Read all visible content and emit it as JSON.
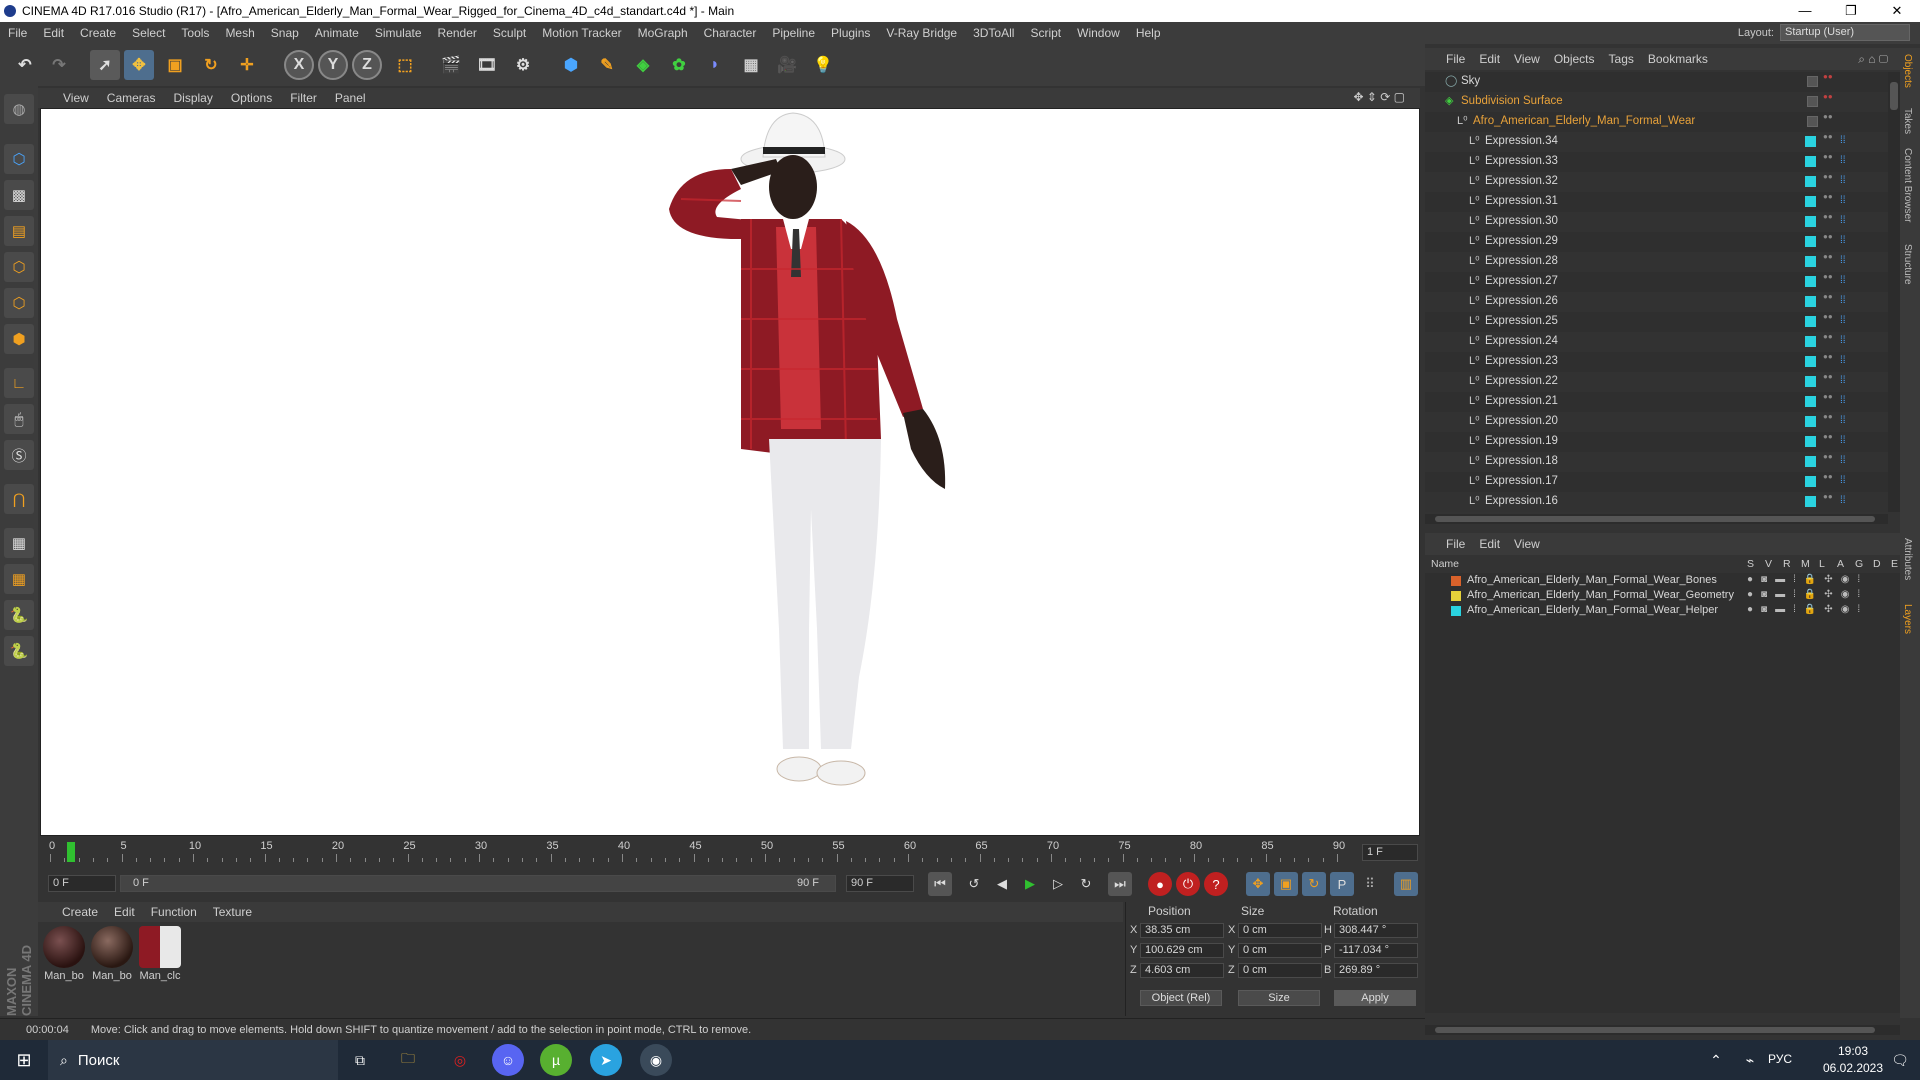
{
  "window": {
    "title": "CINEMA 4D R17.016 Studio (R17) - [Afro_American_Elderly_Man_Formal_Wear_Rigged_for_Cinema_4D_c4d_standart.c4d *] - Main",
    "minimize": "—",
    "maximize": "❐",
    "close": "✕"
  },
  "menubar": {
    "items": [
      "File",
      "Edit",
      "Create",
      "Select",
      "Tools",
      "Mesh",
      "Snap",
      "Animate",
      "Simulate",
      "Render",
      "Sculpt",
      "Motion Tracker",
      "MoGraph",
      "Character",
      "Pipeline",
      "Plugins",
      "V-Ray Bridge",
      "3DToAll",
      "Script",
      "Window",
      "Help"
    ],
    "layout_label": "Layout:",
    "layout_value": "Startup (User)"
  },
  "viewport": {
    "menu": [
      "View",
      "Cameras",
      "Display",
      "Options",
      "Filter",
      "Panel"
    ]
  },
  "timeline": {
    "ticks": [
      "0",
      "5",
      "10",
      "15",
      "20",
      "25",
      "30",
      "35",
      "40",
      "45",
      "50",
      "55",
      "60",
      "65",
      "70",
      "75",
      "80",
      "85",
      "90"
    ],
    "current_frame_right": "1 F",
    "start_field": "0 F",
    "range_start": "0 F",
    "range_end": "90 F",
    "end_field": "90 F"
  },
  "materials": {
    "menu": [
      "Create",
      "Edit",
      "Function",
      "Texture"
    ],
    "items": [
      "Man_bo",
      "Man_bo",
      "Man_clc"
    ]
  },
  "coords": {
    "headers": [
      "Position",
      "Size",
      "Rotation"
    ],
    "rows": [
      {
        "axis": "X",
        "pos": "38.35 cm",
        "saxis": "X",
        "size": "0 cm",
        "raxis": "H",
        "rot": "308.447 °"
      },
      {
        "axis": "Y",
        "pos": "100.629 cm",
        "saxis": "Y",
        "size": "0 cm",
        "raxis": "P",
        "rot": "-117.034 °"
      },
      {
        "axis": "Z",
        "pos": "4.603 cm",
        "saxis": "Z",
        "size": "0 cm",
        "raxis": "B",
        "rot": "269.89 °"
      }
    ],
    "mode": "Object (Rel)",
    "size_mode": "Size",
    "apply": "Apply"
  },
  "status": {
    "time": "00:00:04",
    "message": "Move: Click and drag to move elements. Hold down SHIFT to quantize movement / add to the selection in point mode, CTRL to remove."
  },
  "objects": {
    "menu": [
      "File",
      "Edit",
      "View",
      "Objects",
      "Tags",
      "Bookmarks"
    ],
    "rows": [
      {
        "name": "Sky",
        "level": 0,
        "color": "#d8d8d8"
      },
      {
        "name": "Subdivision Surface",
        "level": 0,
        "color": "#e8a23a"
      },
      {
        "name": "Afro_American_Elderly_Man_Formal_Wear",
        "level": 1,
        "color": "#e8a23a"
      },
      {
        "name": "Expression.34",
        "level": 2,
        "color": "#d8d8d8"
      },
      {
        "name": "Expression.33",
        "level": 2,
        "color": "#d8d8d8"
      },
      {
        "name": "Expression.32",
        "level": 2,
        "color": "#d8d8d8"
      },
      {
        "name": "Expression.31",
        "level": 2,
        "color": "#d8d8d8"
      },
      {
        "name": "Expression.30",
        "level": 2,
        "color": "#d8d8d8"
      },
      {
        "name": "Expression.29",
        "level": 2,
        "color": "#d8d8d8"
      },
      {
        "name": "Expression.28",
        "level": 2,
        "color": "#d8d8d8"
      },
      {
        "name": "Expression.27",
        "level": 2,
        "color": "#d8d8d8"
      },
      {
        "name": "Expression.26",
        "level": 2,
        "color": "#d8d8d8"
      },
      {
        "name": "Expression.25",
        "level": 2,
        "color": "#d8d8d8"
      },
      {
        "name": "Expression.24",
        "level": 2,
        "color": "#d8d8d8"
      },
      {
        "name": "Expression.23",
        "level": 2,
        "color": "#d8d8d8"
      },
      {
        "name": "Expression.22",
        "level": 2,
        "color": "#d8d8d8"
      },
      {
        "name": "Expression.21",
        "level": 2,
        "color": "#d8d8d8"
      },
      {
        "name": "Expression.20",
        "level": 2,
        "color": "#d8d8d8"
      },
      {
        "name": "Expression.19",
        "level": 2,
        "color": "#d8d8d8"
      },
      {
        "name": "Expression.18",
        "level": 2,
        "color": "#d8d8d8"
      },
      {
        "name": "Expression.17",
        "level": 2,
        "color": "#d8d8d8"
      },
      {
        "name": "Expression.16",
        "level": 2,
        "color": "#d8d8d8"
      }
    ]
  },
  "vtabs": [
    "Objects",
    "Takes",
    "Content Browser",
    "Structure",
    "Attributes",
    "Layers"
  ],
  "layers": {
    "menu": [
      "File",
      "Edit",
      "View"
    ],
    "columns": [
      "Name",
      "S",
      "V",
      "R",
      "M",
      "L",
      "A",
      "G",
      "D",
      "E"
    ],
    "rows": [
      {
        "name": "Afro_American_Elderly_Man_Formal_Wear_Bones",
        "color": "#d9622b"
      },
      {
        "name": "Afro_American_Elderly_Man_Formal_Wear_Geometry",
        "color": "#e6d23a"
      },
      {
        "name": "Afro_American_Elderly_Man_Formal_Wear_Helper",
        "color": "#2ad3e0"
      }
    ]
  },
  "sidebar_brand": "MAXON CINEMA 4D",
  "taskbar": {
    "search": "Поиск",
    "lang": "РУС",
    "time": "19:03",
    "date": "06.02.2023"
  }
}
